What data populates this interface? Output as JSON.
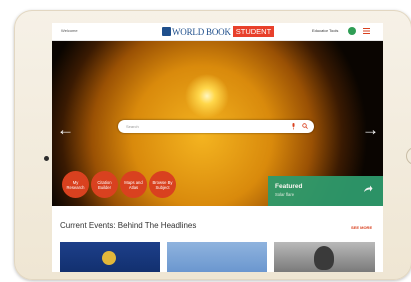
{
  "topbar": {
    "welcome": "Welcome",
    "logo_text": "WORLD BOOK",
    "logo_badge": "STUDENT",
    "educator_tools": "Educator Tools"
  },
  "hero": {
    "search_placeholder": "Search",
    "quick_links": [
      {
        "label": "My Research"
      },
      {
        "label": "Citation Builder"
      },
      {
        "label": "Maps and Atlas"
      },
      {
        "label": "Browse By Subject"
      }
    ],
    "featured": {
      "title": "Featured",
      "subtitle": "Solar flare"
    }
  },
  "section": {
    "title": "Current Events: Behind The Headlines",
    "see_more": "SEE MORE"
  },
  "colors": {
    "brand_blue": "#1f4f8c",
    "student_red": "#e8402b",
    "quick_orange": "#d9411f",
    "featured_green": "#2e9a6c",
    "avatar_green": "#2f9e55"
  },
  "icons": {
    "left": "chevron-left-icon",
    "right": "chevron-right-icon",
    "mic": "microphone-icon",
    "search": "search-icon",
    "share": "share-arrow-icon",
    "menu": "hamburger-menu-icon"
  }
}
